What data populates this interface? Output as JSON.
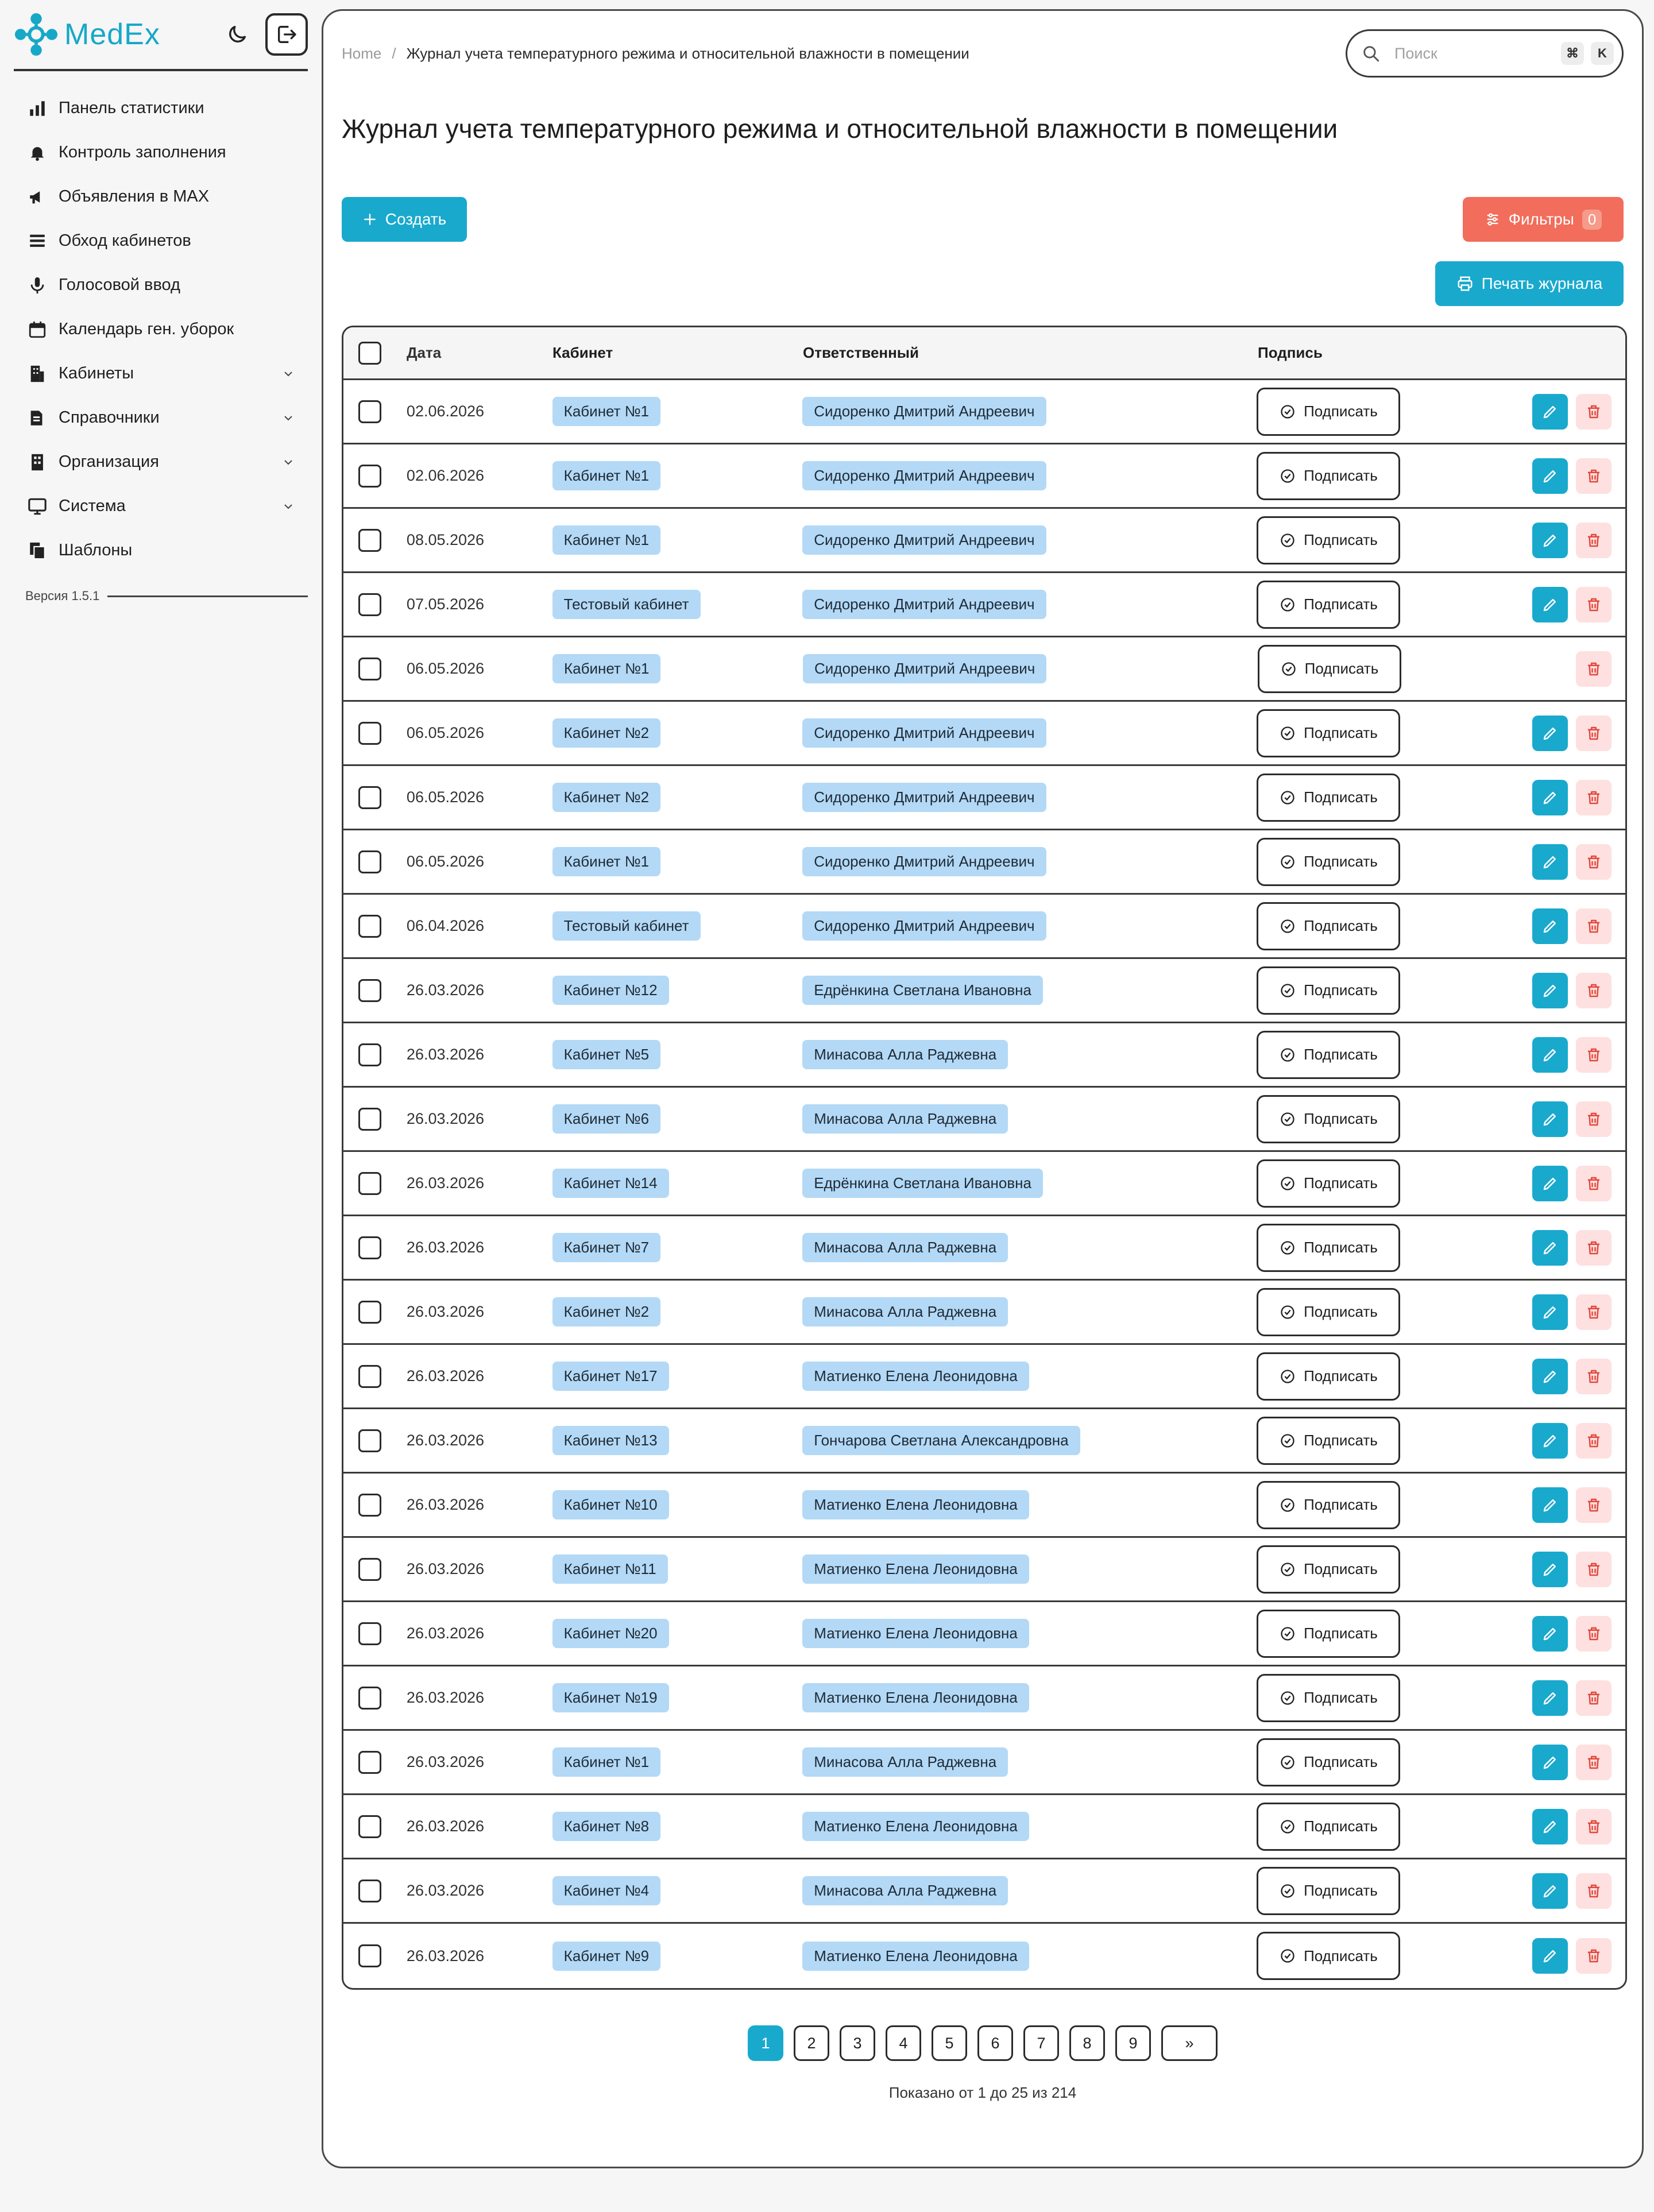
{
  "brand": {
    "name": "MedEx",
    "color": "#17a8c7"
  },
  "sidebar": {
    "items": [
      {
        "label": "Панель статистики",
        "icon": "bar-chart-icon",
        "expandable": false
      },
      {
        "label": "Контроль заполнения",
        "icon": "bell-icon",
        "expandable": false
      },
      {
        "label": "Объявления в MAX",
        "icon": "megaphone-icon",
        "expandable": false
      },
      {
        "label": "Обход кабинетов",
        "icon": "list-icon",
        "expandable": false
      },
      {
        "label": "Голосовой ввод",
        "icon": "microphone-icon",
        "expandable": false
      },
      {
        "label": "Календарь ген. уборок",
        "icon": "calendar-icon",
        "expandable": false
      },
      {
        "label": "Кабинеты",
        "icon": "building-icon",
        "expandable": true
      },
      {
        "label": "Справочники",
        "icon": "book-icon",
        "expandable": true
      },
      {
        "label": "Организация",
        "icon": "office-icon",
        "expandable": true
      },
      {
        "label": "Система",
        "icon": "monitor-icon",
        "expandable": true
      },
      {
        "label": "Шаблоны",
        "icon": "copy-icon",
        "expandable": false
      }
    ],
    "version": "Версия 1.5.1"
  },
  "breadcrumb": {
    "home": "Home",
    "separator": "/",
    "current": "Журнал учета температурного режима и относительной влажности в помещении"
  },
  "search": {
    "placeholder": "Поиск",
    "shortcut_keys": [
      "⌘",
      "K"
    ]
  },
  "page": {
    "title": "Журнал учета температурного режима и относительной влажности в помещении"
  },
  "toolbar": {
    "create_label": "Создать",
    "filters_label": "Фильтры",
    "filters_count": "0",
    "print_label": "Печать журнала"
  },
  "colors": {
    "accent": "#19a9cd",
    "danger": "#f26d5b",
    "chip": "#b3d9f6"
  },
  "table": {
    "columns": [
      "Дата",
      "Кабинет",
      "Ответственный",
      "Подпись"
    ],
    "sign_label": "Подписать",
    "rows": [
      {
        "date": "02.06.2026",
        "cabinet": "Кабинет №1",
        "responsible": "Сидоренко Дмитрий Андреевич",
        "editable": true
      },
      {
        "date": "02.06.2026",
        "cabinet": "Кабинет №1",
        "responsible": "Сидоренко Дмитрий Андреевич",
        "editable": true
      },
      {
        "date": "08.05.2026",
        "cabinet": "Кабинет №1",
        "responsible": "Сидоренко Дмитрий Андреевич",
        "editable": true
      },
      {
        "date": "07.05.2026",
        "cabinet": "Тестовый кабинет",
        "responsible": "Сидоренко Дмитрий Андреевич",
        "editable": true
      },
      {
        "date": "06.05.2026",
        "cabinet": "Кабинет №1",
        "responsible": "Сидоренко Дмитрий Андреевич",
        "editable": false
      },
      {
        "date": "06.05.2026",
        "cabinet": "Кабинет №2",
        "responsible": "Сидоренко Дмитрий Андреевич",
        "editable": true
      },
      {
        "date": "06.05.2026",
        "cabinet": "Кабинет №2",
        "responsible": "Сидоренко Дмитрий Андреевич",
        "editable": true
      },
      {
        "date": "06.05.2026",
        "cabinet": "Кабинет №1",
        "responsible": "Сидоренко Дмитрий Андреевич",
        "editable": true
      },
      {
        "date": "06.04.2026",
        "cabinet": "Тестовый кабинет",
        "responsible": "Сидоренко Дмитрий Андреевич",
        "editable": true
      },
      {
        "date": "26.03.2026",
        "cabinet": "Кабинет №12",
        "responsible": "Едрёнкина Светлана Ивановна",
        "editable": true
      },
      {
        "date": "26.03.2026",
        "cabinet": "Кабинет №5",
        "responsible": "Минасова Алла Раджевна",
        "editable": true
      },
      {
        "date": "26.03.2026",
        "cabinet": "Кабинет №6",
        "responsible": "Минасова Алла Раджевна",
        "editable": true
      },
      {
        "date": "26.03.2026",
        "cabinet": "Кабинет №14",
        "responsible": "Едрёнкина Светлана Ивановна",
        "editable": true
      },
      {
        "date": "26.03.2026",
        "cabinet": "Кабинет №7",
        "responsible": "Минасова Алла Раджевна",
        "editable": true
      },
      {
        "date": "26.03.2026",
        "cabinet": "Кабинет №2",
        "responsible": "Минасова Алла Раджевна",
        "editable": true
      },
      {
        "date": "26.03.2026",
        "cabinet": "Кабинет №17",
        "responsible": "Матиенко Елена Леонидовна",
        "editable": true
      },
      {
        "date": "26.03.2026",
        "cabinet": "Кабинет №13",
        "responsible": "Гончарова Светлана Александровна",
        "editable": true
      },
      {
        "date": "26.03.2026",
        "cabinet": "Кабинет №10",
        "responsible": "Матиенко Елена Леонидовна",
        "editable": true
      },
      {
        "date": "26.03.2026",
        "cabinet": "Кабинет №11",
        "responsible": "Матиенко Елена Леонидовна",
        "editable": true
      },
      {
        "date": "26.03.2026",
        "cabinet": "Кабинет №20",
        "responsible": "Матиенко Елена Леонидовна",
        "editable": true
      },
      {
        "date": "26.03.2026",
        "cabinet": "Кабинет №19",
        "responsible": "Матиенко Елена Леонидовна",
        "editable": true
      },
      {
        "date": "26.03.2026",
        "cabinet": "Кабинет №1",
        "responsible": "Минасова Алла Раджевна",
        "editable": true
      },
      {
        "date": "26.03.2026",
        "cabinet": "Кабинет №8",
        "responsible": "Матиенко Елена Леонидовна",
        "editable": true
      },
      {
        "date": "26.03.2026",
        "cabinet": "Кабинет №4",
        "responsible": "Минасова Алла Раджевна",
        "editable": true
      },
      {
        "date": "26.03.2026",
        "cabinet": "Кабинет №9",
        "responsible": "Матиенко Елена Леонидовна",
        "editable": true
      }
    ]
  },
  "pagination": {
    "pages": [
      "1",
      "2",
      "3",
      "4",
      "5",
      "6",
      "7",
      "8",
      "9"
    ],
    "current": "1",
    "next_label": "»",
    "summary": "Показано от 1 до 25 из 214"
  }
}
